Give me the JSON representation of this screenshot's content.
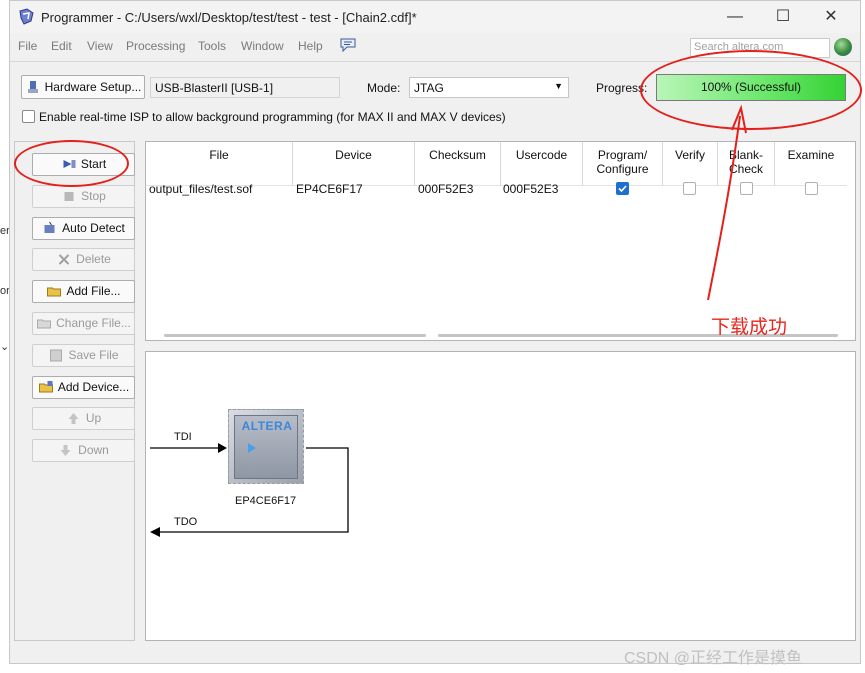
{
  "window": {
    "title": "Programmer - C:/Users/wxl/Desktop/test/test - test - [Chain2.cdf]*",
    "controls": [
      "—",
      "☐",
      "✕"
    ]
  },
  "menu": [
    "File",
    "Edit",
    "View",
    "Processing",
    "Tools",
    "Window",
    "Help"
  ],
  "search": {
    "placeholder": "Search altera.com"
  },
  "hardware": {
    "button": "Hardware Setup...",
    "value": "USB-BlasterII [USB-1]"
  },
  "mode": {
    "label": "Mode:",
    "value": "JTAG"
  },
  "progress": {
    "label": "Progress:",
    "text": "100% (Successful)",
    "percent": 100
  },
  "isp": {
    "label": "Enable real-time ISP to allow background programming (for MAX II and MAX V devices)",
    "checked": false
  },
  "side_buttons": [
    {
      "label": "Start",
      "enabled": true
    },
    {
      "label": "Stop",
      "enabled": false
    },
    {
      "label": "Auto Detect",
      "enabled": true
    },
    {
      "label": "Delete",
      "enabled": false
    },
    {
      "label": "Add File...",
      "enabled": true
    },
    {
      "label": "Change File...",
      "enabled": false
    },
    {
      "label": "Save File",
      "enabled": false
    },
    {
      "label": "Add Device...",
      "enabled": true
    },
    {
      "label": "Up",
      "enabled": false
    },
    {
      "label": "Down",
      "enabled": false
    }
  ],
  "table": {
    "headers": [
      "File",
      "Device",
      "Checksum",
      "Usercode",
      "Program/\nConfigure",
      "Verify",
      "Blank-\nCheck",
      "Examine"
    ],
    "rows": [
      {
        "file": "output_files/test.sof",
        "device": "EP4CE6F17",
        "checksum": "000F52E3",
        "usercode": "000F52E3",
        "program": true,
        "verify": false,
        "blank": false,
        "examine": false
      }
    ]
  },
  "diagram": {
    "tdi": "TDI",
    "tdo": "TDO",
    "chip_logo": "ALTERA",
    "device": "EP4CE6F17"
  },
  "annotation": {
    "text": "下载成功",
    "color": "#e8271e"
  },
  "watermark": "CSDN @正经工作是摸鱼",
  "left_fragments": [
    "er",
    "or",
    "⌄"
  ]
}
